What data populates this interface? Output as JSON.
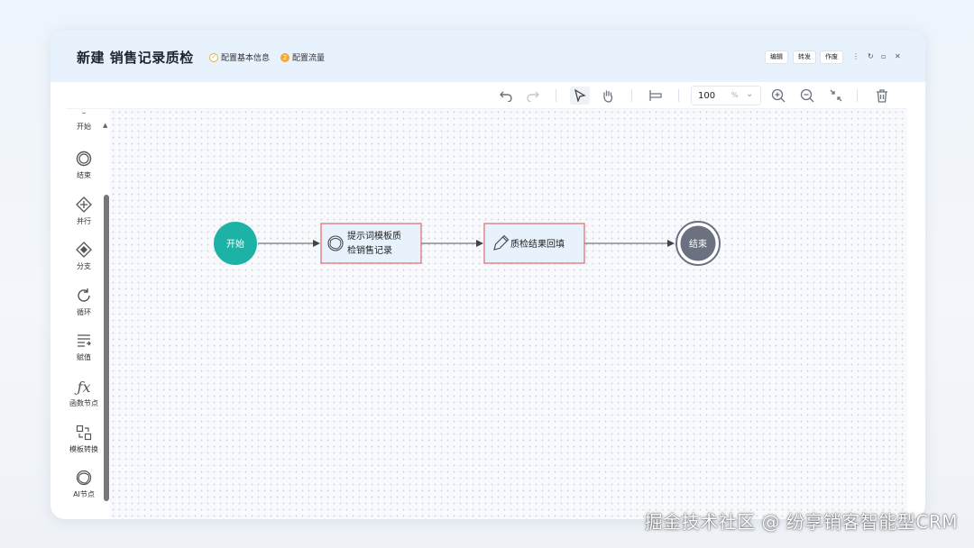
{
  "header": {
    "title": "新建  销售记录质检",
    "step1_label": "配置基本信息",
    "step2_label": "配置流量",
    "buttons": [
      "编辑",
      "转发",
      "作废"
    ]
  },
  "toolbar": {
    "zoom_value": "100",
    "zoom_unit": "%"
  },
  "sidebar": {
    "items": [
      {
        "label": "开始",
        "icon": "start-icon"
      },
      {
        "label": "结束",
        "icon": "end-circle-icon"
      },
      {
        "label": "并行",
        "icon": "parallel-gateway-icon"
      },
      {
        "label": "分支",
        "icon": "branch-gateway-icon"
      },
      {
        "label": "循环",
        "icon": "loop-icon"
      },
      {
        "label": "赋值",
        "icon": "assign-icon"
      },
      {
        "label": "函数节点",
        "icon": "function-icon"
      },
      {
        "label": "模板转换",
        "icon": "template-convert-icon"
      },
      {
        "label": "AI节点",
        "icon": "ai-node-icon"
      }
    ]
  },
  "flow": {
    "start_label": "开始",
    "node1_line1": "提示词模板质",
    "node1_line2": "检销售记录",
    "node2_label": "质检结果回填",
    "end_label": "结束"
  },
  "colors": {
    "start": "#1cb3a6",
    "end": "#6b7180",
    "node_border": "#e26a6a",
    "node_fill": "#e8f2fc"
  },
  "watermark": "掘金技术社区 @ 纷享销客智能型CRM"
}
